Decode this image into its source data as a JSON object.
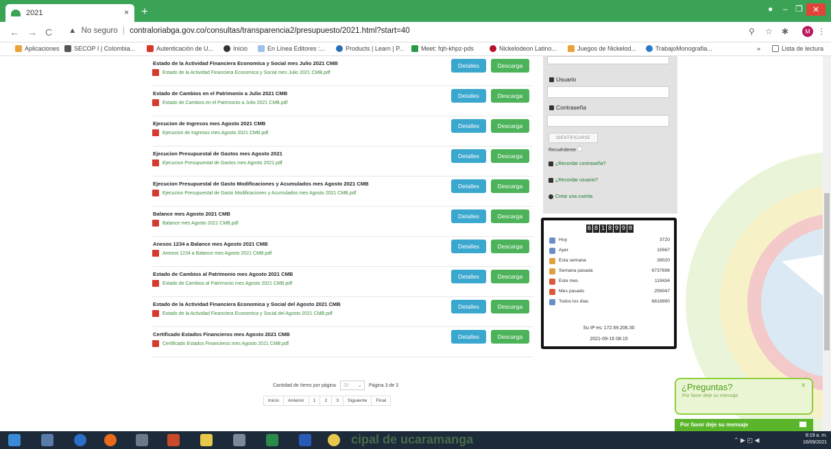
{
  "browser": {
    "tab_title": "2021",
    "tab_close": "×",
    "new_tab": "+",
    "nav_back": "←",
    "nav_forward": "→",
    "nav_reload": "C",
    "url_warning": "No seguro",
    "url": "contraloriabga.gov.co/consultas/transparencia2/presupuesto/2021.html?start=40",
    "bookmarks": [
      "Aplicaciones",
      "SECOP I | Colombia...",
      "Autenticación de U...",
      "Inicio",
      "En Línea Editores :...",
      "Products | Learn | P...",
      "Meet: fqh-khpz-pds",
      "Nickelodeon Latino...",
      "Juegos de Nickelod...",
      "TrabajoMonografia...",
      "»",
      "Lista de lectura"
    ],
    "avatar_letter": "M"
  },
  "documents": [
    {
      "title": "Estado de la Actividad Financiera Economica y Social mes Julio 2021 CMB",
      "file": "Estado de la Actividad Financiera Economica y Social mes Julio 2021 CMB.pdf"
    },
    {
      "title": "Estado de Cambios en el Patrimonio a Julio 2021 CMB",
      "file": "Estado de Cambios en el Patrimonio a Julio 2021 CMB.pdf"
    },
    {
      "title": "Ejecucion de Ingresos mes Agosto 2021 CMB",
      "file": "Ejecucion de Ingresos mes Agosto 2021 CMB.pdf"
    },
    {
      "title": "Ejecucion Presupuestal de Gastos mes Agosto 2021",
      "file": "Ejecucion Presupuestal de Gastos mes Agosto 2021.pdf"
    },
    {
      "title": "Ejecucion Presupuestal de Gasto Modificaciones y Acumulados mes Agosto 2021 CMB",
      "file": "Ejecucion Presupuestal de Gasto Modificaciones y Acumulados mes Agosto 2021 CMB.pdf"
    },
    {
      "title": "Balance mes Agosto 2021 CMB",
      "file": "Balance mes Agosto 2021 CMB.pdf"
    },
    {
      "title": "Anexos 1234 a Balance mes Agosto 2021 CMB",
      "file": "Anexos 1234 a Balance mes Agosto 2021 CMB.pdf"
    },
    {
      "title": "Estado de Cambios al Patrimonio mes Agosto 2021 CMB",
      "file": "Estado de Cambios al Patrimonio mes Agosto 2021 CMB.pdf"
    },
    {
      "title": "Estado de la Actividad Financiera Economica y Social del Agosto 2021 CMB",
      "file": "Estado de la Actividad Financiera Economica y Social del Agosto 2021 CMB.pdf"
    },
    {
      "title": "Certificado Estados Financieros mes Agosto 2021 CMB",
      "file": "Certificado Estados Financieros mes Agosto 2021 CMB.pdf"
    }
  ],
  "buttons": {
    "details": "Detalles",
    "download": "Descarga"
  },
  "pagination": {
    "items_label": "Cantidad de ítems por página",
    "items_value": "20",
    "page_label": "Página 3 de 3",
    "links": [
      "Inicio",
      "Anterior",
      "1",
      "2",
      "3",
      "Siguiente",
      "Final"
    ]
  },
  "login": {
    "user_label": "Usuario",
    "password_label": "Contraseña",
    "submit": "IDENTIFICARSE",
    "remember": "Recuérdeme",
    "forgot_password": "¿Recordar contraseña?",
    "forgot_user": "¿Recordar usuario?",
    "create_account": "Crear una cuenta"
  },
  "counter": {
    "digits": [
      "6",
      "8",
      "1",
      "8",
      "9",
      "9",
      "0"
    ],
    "rows": [
      {
        "label": "Hoy",
        "value": "3720",
        "color": "#6a8fc8"
      },
      {
        "label": "Ayer",
        "value": "15567",
        "color": "#6a8fc8"
      },
      {
        "label": "Esta semana",
        "value": "39020",
        "color": "#e0a040"
      },
      {
        "label": "Semana pasada",
        "value": "6737696",
        "color": "#e0a040"
      },
      {
        "label": "Este mes",
        "value": "119434",
        "color": "#d85a3a"
      },
      {
        "label": "Mes pasado",
        "value": "259047",
        "color": "#d85a3a"
      },
      {
        "label": "Todos los días",
        "value": "6818990",
        "color": "#6a8fc8"
      }
    ],
    "ip": "Su IP es: 172.69.206.30",
    "datetime": "2021-09-16 08:15"
  },
  "chat": {
    "title": "¿Preguntas?",
    "subtitle": "Por favor deje su mensaje",
    "close": "x",
    "bar": "Por favor deje su mensaje"
  },
  "taskbar": {
    "overlay_text": "cipal de  ucaramanga",
    "time": "8:19 a. m.",
    "date": "16/09/2021"
  }
}
